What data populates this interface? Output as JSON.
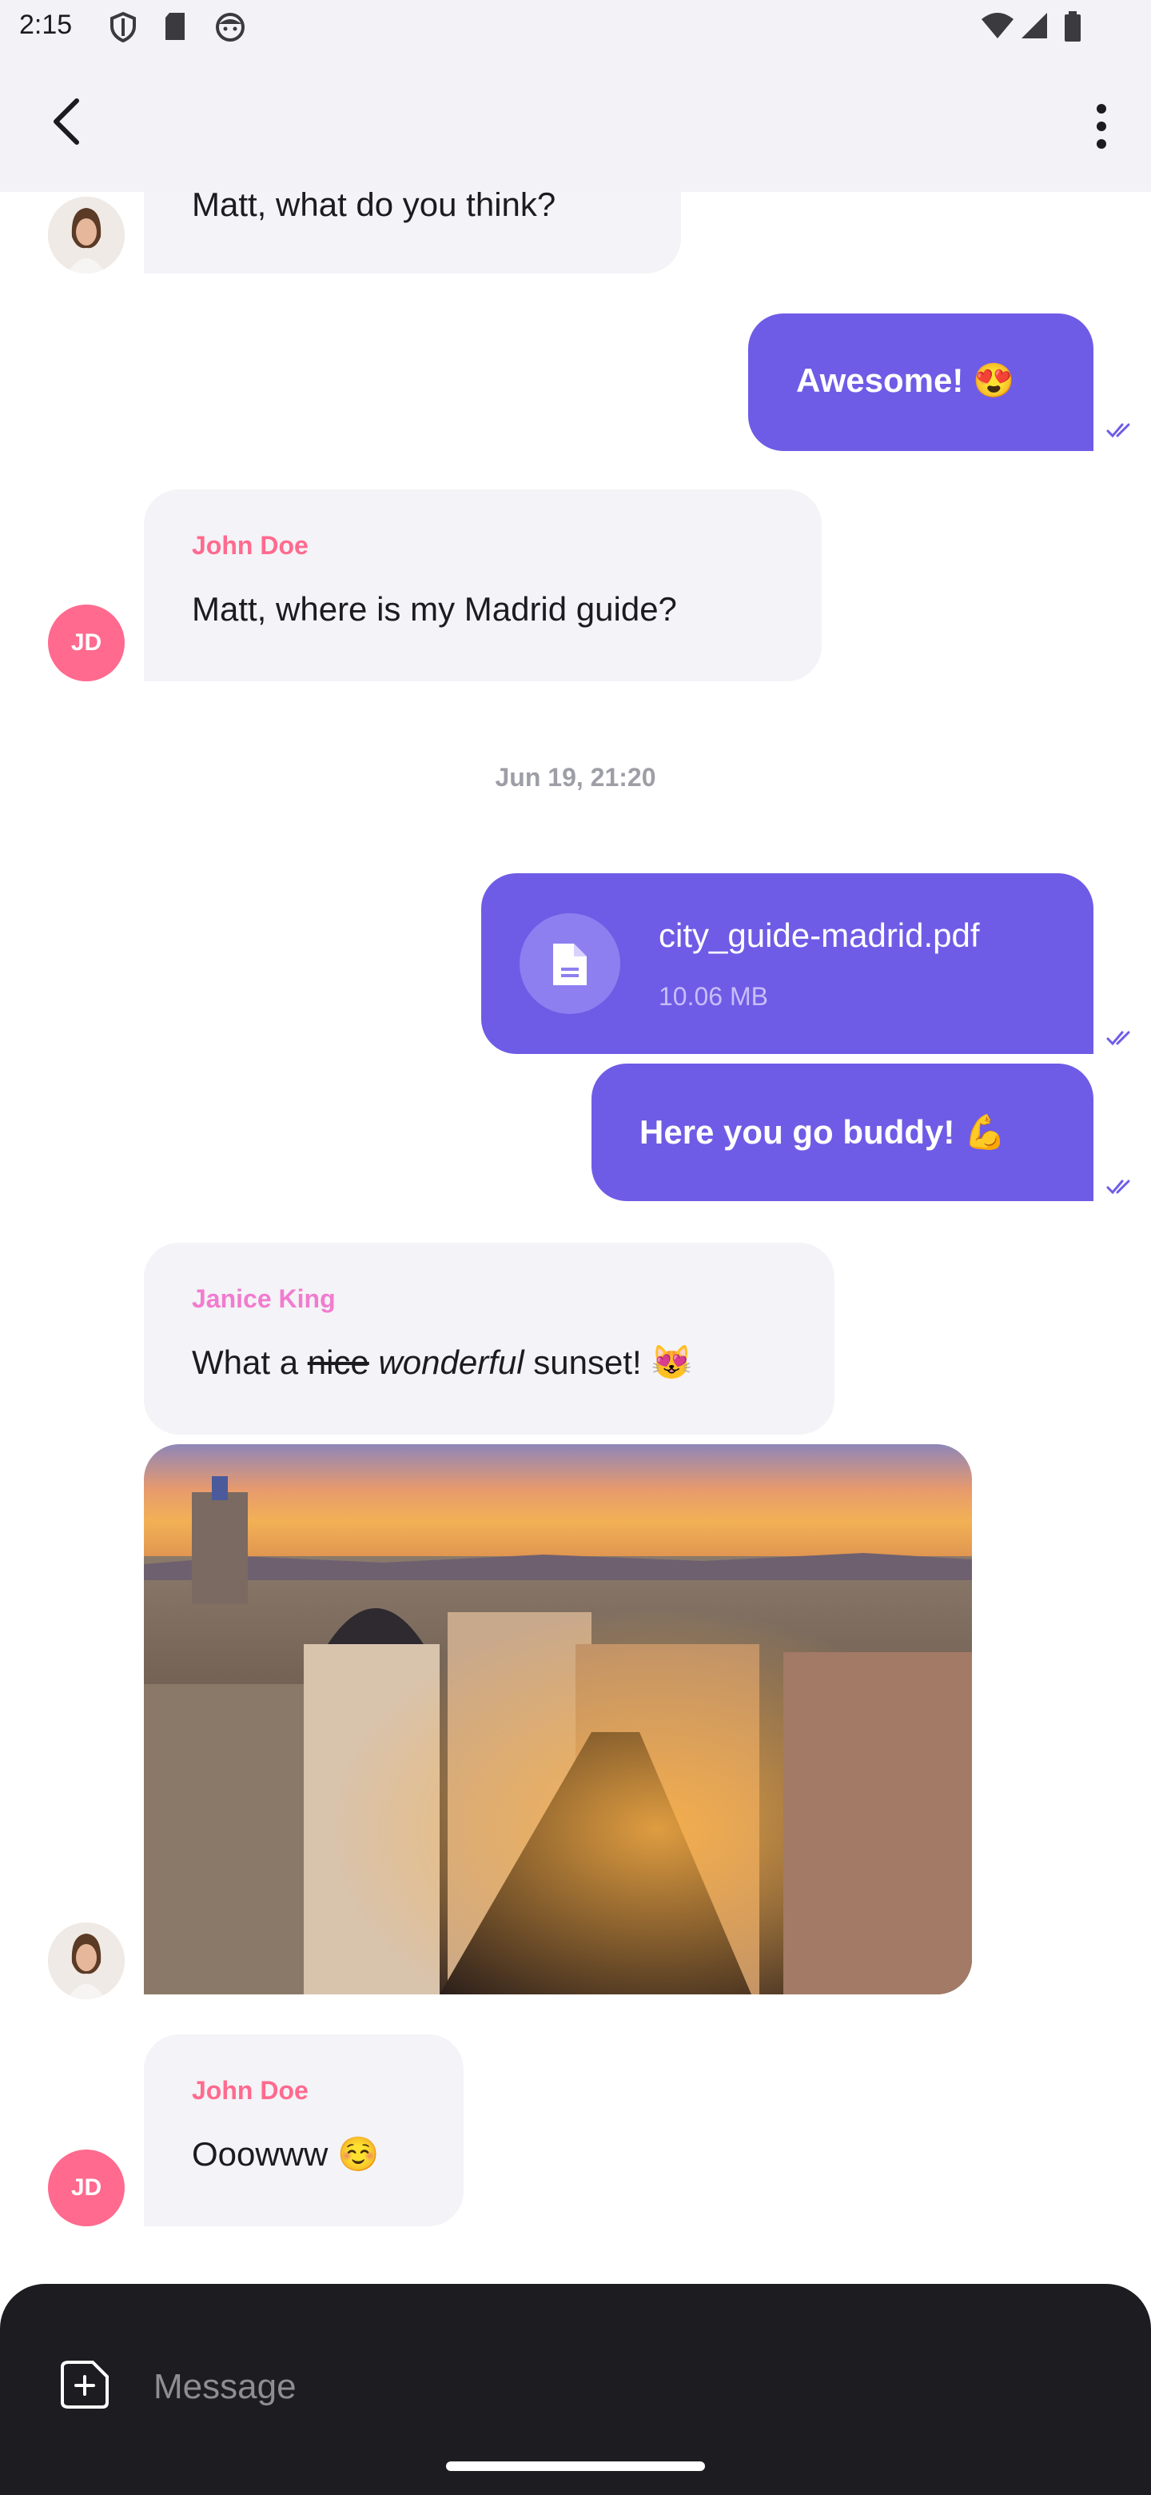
{
  "status_bar": {
    "time": "2:15"
  },
  "app_bar": {
    "back_icon": "arrow-back-icon",
    "menu_icon": "more-vert-icon"
  },
  "messages": {
    "m1": {
      "text": "Matt, what do you think?"
    },
    "m2": {
      "text": "Awesome! 😍"
    },
    "m3": {
      "author": "John Doe",
      "text": "Matt, where is my Madrid guide?",
      "avatar": "JD"
    },
    "date_separator": "Jun 19, 21:20",
    "m4": {
      "file_name": "city_guide-madrid.pdf",
      "file_size": "10.06 MB"
    },
    "m5": {
      "text": "Here you go buddy! 💪"
    },
    "m6": {
      "author": "Janice King",
      "text_prefix": "What a ",
      "text_strike": "nice",
      "text_italic": "wonderful",
      "text_suffix": " sunset! 😻"
    },
    "m8": {
      "author": "John Doe",
      "text": "Ooowww ☺️",
      "avatar": "JD"
    }
  },
  "composer": {
    "placeholder": "Message"
  },
  "colors": {
    "accent": "#6e5ce6",
    "john_doe": "#ff6a8e",
    "janice_king": "#f17ccf",
    "incoming_bubble": "#f4f3f7",
    "composer_bg": "#1d1c21"
  }
}
